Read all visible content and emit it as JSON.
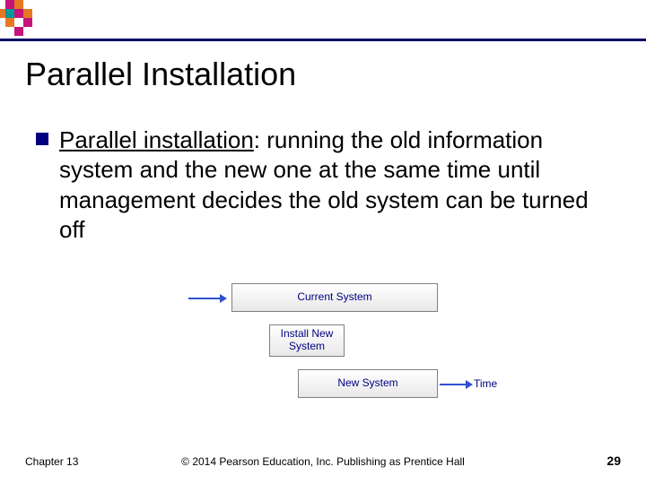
{
  "logo": {
    "colors": {
      "magenta": "#c4137a",
      "orange": "#e87722",
      "teal": "#009999"
    }
  },
  "title": "Parallel Installation",
  "bullet": {
    "term": "Parallel installation",
    "definition": ": running the old information system and the new one at the same time until management decides the old system can be turned off"
  },
  "diagram": {
    "current_system": "Current System",
    "install_new": "Install New\nSystem",
    "new_system": "New System",
    "time_label": "Time"
  },
  "footer": {
    "chapter": "Chapter 13",
    "copyright": "© 2014 Pearson Education, Inc. Publishing as Prentice Hall",
    "page": "29"
  }
}
